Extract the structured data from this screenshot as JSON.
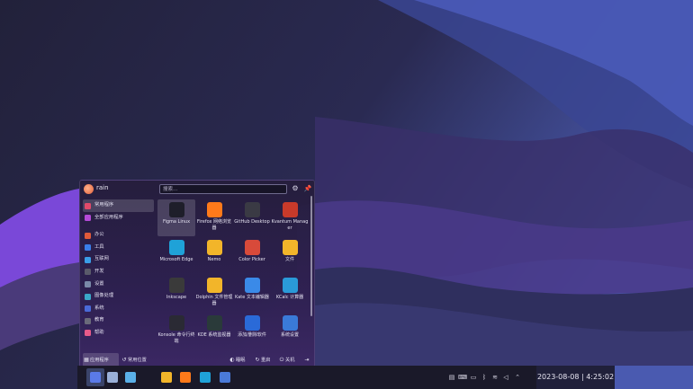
{
  "launcher": {
    "username": "rain",
    "search_placeholder": "搜索...",
    "sidebar": [
      {
        "label": "常用程序",
        "color": "#e24a6a",
        "active": true
      },
      {
        "label": "全部应用程序",
        "color": "#b44ad8"
      },
      {
        "label": "办公",
        "color": "#e05a3a"
      },
      {
        "label": "工具",
        "color": "#3a7ee8"
      },
      {
        "label": "互联网",
        "color": "#3a9ee8"
      },
      {
        "label": "开发",
        "color": "#5a5a6a"
      },
      {
        "label": "设置",
        "color": "#7a8aa8"
      },
      {
        "label": "图像处理",
        "color": "#3aa8c8"
      },
      {
        "label": "系统",
        "color": "#4a6ad8"
      },
      {
        "label": "教育",
        "color": "#6a6a7a"
      },
      {
        "label": "帮助",
        "color": "#e85a8a"
      }
    ],
    "apps": [
      {
        "label": "Figma Linux",
        "color": "#1e1e2a",
        "active": true
      },
      {
        "label": "Firefox 网络浏览器",
        "color": "#ff7a1a"
      },
      {
        "label": "GitHub Desktop",
        "color": "#3a3a44"
      },
      {
        "label": "Kvantum Manager",
        "color": "#c83a2a"
      },
      {
        "label": "Microsoft Edge",
        "color": "#1fa2d8"
      },
      {
        "label": "Nemo",
        "color": "#f2b52a"
      },
      {
        "label": "Color Picker",
        "color": "#d84a3a"
      },
      {
        "label": "文件",
        "color": "#f2b52a"
      },
      {
        "label": "Inkscape",
        "color": "#3a3a3a"
      },
      {
        "label": "Dolphin 文件管理器",
        "color": "#f2b52a"
      },
      {
        "label": "Kate 文本编辑器",
        "color": "#3a8ae8"
      },
      {
        "label": "KCalc 计算器",
        "color": "#2a9ad8"
      },
      {
        "label": "Konsole 命令行终端",
        "color": "#2a2a34"
      },
      {
        "label": "KDE 系统监视器",
        "color": "#2a3a3a"
      },
      {
        "label": "添加/删除软件",
        "color": "#2a6ad8"
      },
      {
        "label": "系统设置",
        "color": "#3a7ad8"
      }
    ],
    "footer": {
      "apps_tab": "应用程序",
      "places_tab": "常用位置",
      "sleep": "睡眠",
      "restart": "重启",
      "shutdown": "关机"
    }
  },
  "taskbar": {
    "items": [
      {
        "name": "launcher",
        "color": "#5a7ae8",
        "active": true
      },
      {
        "name": "desktop-pager-1",
        "color": "#9ab0d8"
      },
      {
        "name": "desktop-pager-2",
        "color": "#5ab0e8"
      },
      {
        "name": "files",
        "color": "#f2b52a"
      },
      {
        "name": "firefox",
        "color": "#ff7a1a"
      },
      {
        "name": "edge",
        "color": "#1fa2d8"
      },
      {
        "name": "settings",
        "color": "#4a7ad8"
      }
    ],
    "clock": "2023-08-08 | 4:25:02"
  }
}
